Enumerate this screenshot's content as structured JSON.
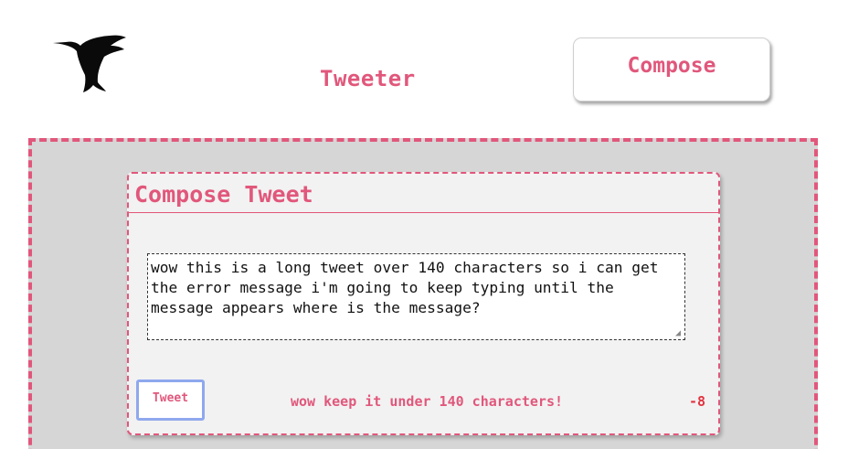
{
  "header": {
    "logo_icon": "hummingbird-icon",
    "title": "Tweeter",
    "compose_label": "Compose"
  },
  "compose": {
    "title": "Compose Tweet",
    "textarea_value": "wow this is a long tweet over 140 characters so i can get the error message i'm going to keep typing until the message appears where is the message?",
    "tweet_label": "Tweet",
    "error_message": "wow keep it under 140 characters!",
    "char_count": "-8"
  },
  "colors": {
    "accent": "#e1577b",
    "region_bg": "#d6d6d6",
    "card_bg": "#f2f2f2",
    "tweet_button_border": "#8fa8ee",
    "counter_negative": "#e2323f"
  }
}
